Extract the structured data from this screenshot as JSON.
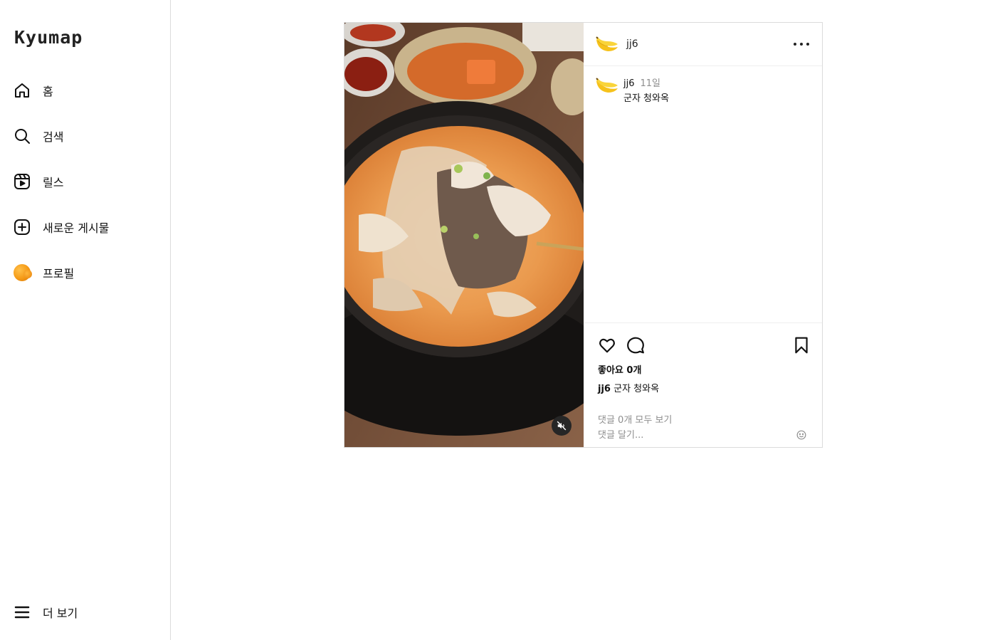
{
  "app": {
    "logo": "Kyumap"
  },
  "sidebar": {
    "items": [
      {
        "label": "홈",
        "icon": "home-icon"
      },
      {
        "label": "검색",
        "icon": "search-icon"
      },
      {
        "label": "릴스",
        "icon": "reels-icon"
      },
      {
        "label": "새로운 게시물",
        "icon": "new-post-icon"
      },
      {
        "label": "프로필",
        "icon": "profile-avatar"
      }
    ],
    "more": {
      "label": "더 보기",
      "icon": "menu-icon"
    }
  },
  "post": {
    "author": "jj6",
    "author_avatar": "banana-icon",
    "caption": {
      "user": "jj6",
      "time": "11일",
      "text": "군자 청와옥"
    },
    "likes_label": "좋아요 0개",
    "caption_line": {
      "user": "jj6",
      "text": "군자 청와옥"
    },
    "view_comments": "댓글 0개 모두 보기",
    "comment_placeholder": "댓글 달기..."
  }
}
